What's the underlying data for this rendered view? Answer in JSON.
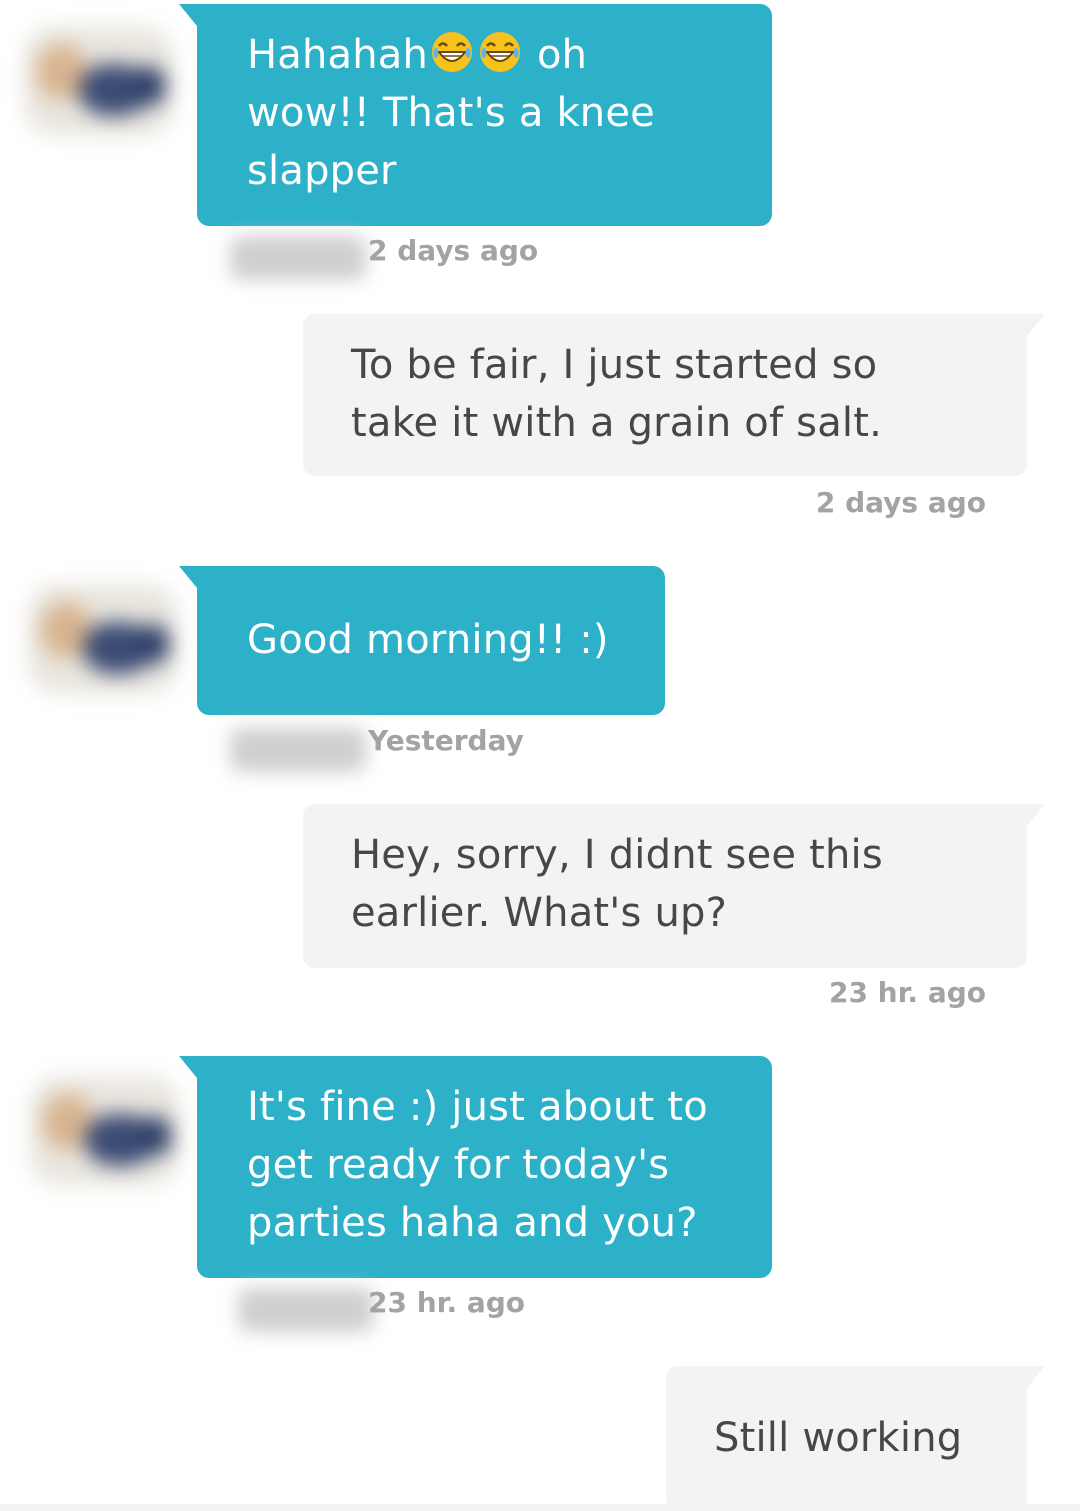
{
  "messages": [
    {
      "direction": "incoming",
      "text_parts": [
        "Hahahah",
        "oh",
        "wow!! That's a knee",
        "slapper"
      ],
      "emojis": [
        "tears-of-joy-emoji",
        "tears-of-joy-emoji"
      ],
      "timestamp": "2 days ago"
    },
    {
      "direction": "outgoing",
      "lines": [
        "To be fair, I just started so",
        "take it with a grain of salt."
      ],
      "timestamp": "2 days ago"
    },
    {
      "direction": "incoming",
      "lines": [
        "Good morning!! :)"
      ],
      "timestamp": "Yesterday"
    },
    {
      "direction": "outgoing",
      "lines": [
        "Hey, sorry, I didnt see this",
        "earlier. What's up?"
      ],
      "timestamp": "23 hr. ago"
    },
    {
      "direction": "incoming",
      "lines": [
        "It's fine :) just about to",
        "get ready for today's",
        "parties haha and you?"
      ],
      "timestamp": "23 hr. ago"
    },
    {
      "direction": "outgoing",
      "lines": [
        "Still working"
      ]
    }
  ],
  "colors": {
    "incoming_bubble": "#2db1c9",
    "outgoing_bubble": "#f3f3f3",
    "incoming_text": "#ffffff",
    "outgoing_text": "#474747",
    "timestamp": "#a3a3a3"
  }
}
